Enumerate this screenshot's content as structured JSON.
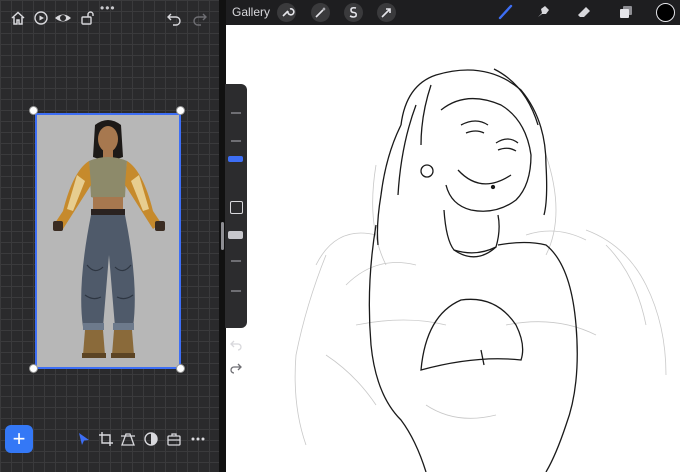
{
  "topbar": {
    "gallery_label": "Gallery"
  },
  "left_toolbar": {
    "icons": [
      "home-icon",
      "play-icon",
      "eye-icon",
      "unlock-icon",
      "undo-icon",
      "redo-icon"
    ]
  },
  "bottom_toolbar": {
    "add_label": "+",
    "icons": [
      "select-arrow-icon",
      "crop-icon",
      "perspective-icon",
      "adjust-icon",
      "toolbox-icon",
      "more-icon"
    ]
  },
  "more_dots": "•••",
  "colors": {
    "accent": "#3d6ef5",
    "add_button": "#3478f6",
    "color_swatch": "#000000"
  }
}
